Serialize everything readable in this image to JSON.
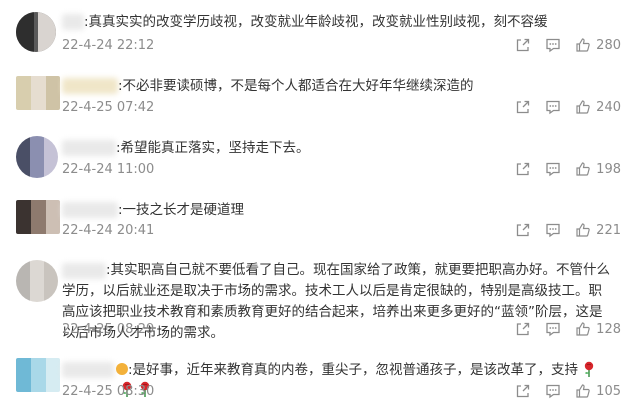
{
  "comments": [
    {
      "text": ":真真实实的改变学历歧视，改变就业年龄歧视，改变就业性别歧视，刻不容缓",
      "time": "22-4-24 22:12",
      "likes": "280"
    },
    {
      "text": ":不必非要读硕博，不是每个人都适合在大好年华继续深造的",
      "time": "22-4-25 07:42",
      "likes": "240"
    },
    {
      "text": ":希望能真正落实，坚持走下去。",
      "time": "22-4-24 11:00",
      "likes": "198"
    },
    {
      "text": ":一技之长才是硬道理",
      "time": "22-4-24 20:41",
      "likes": "221"
    },
    {
      "text": ":其实职高自己就不要低看了自己。现在国家给了政策，就更要把职高办好。不管什么学历，以后就业还是取决于市场的需求。技术工人以后是肯定很缺的，特别是高级技工。职高应该把职业技术教育和素质教育更好的结合起来，培养出来更多更好的“蓝领”阶层，这是以后市场人才市场的需求。",
      "time": "22-4-25 08:29",
      "likes": "128"
    },
    {
      "text": ":是好事，近年来教育真的内卷，重尖子，忽视普通孩子，是该改革了，支持",
      "time": "22-4-25 08:30",
      "likes": "105"
    }
  ],
  "icons": {
    "share": "share-icon",
    "comment": "comment-icon",
    "like": "like-icon",
    "rose": "rose-emoji-icon",
    "face": "grin-emoji-icon"
  }
}
